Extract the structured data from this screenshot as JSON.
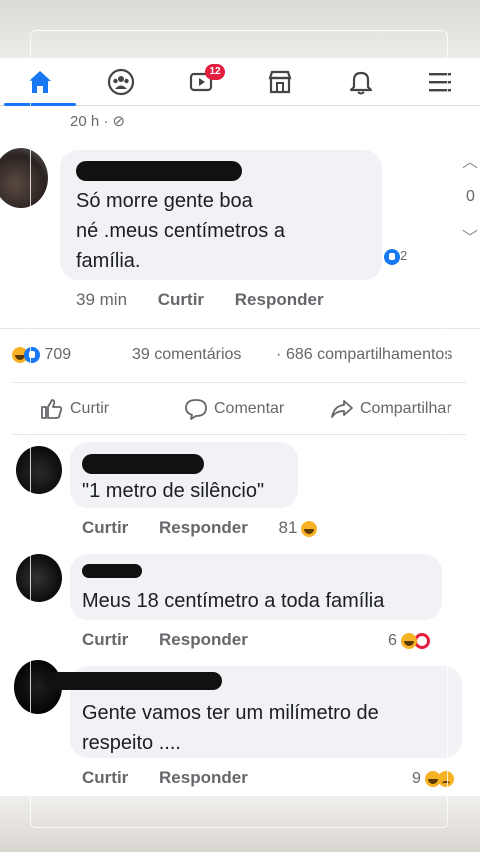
{
  "nav": {
    "notifications_badge": "12",
    "accent_color": "#1877f2",
    "icons": [
      "home-icon",
      "groups-icon",
      "watch-icon",
      "marketplace-icon",
      "bell-icon",
      "menu-icon"
    ]
  },
  "post_timestamp": "20 h · ",
  "main_comment": {
    "text_line1": "Só morre gente boa",
    "text_line2": "né .meus centímetros a",
    "text_line3": "família.",
    "reaction_count": "2",
    "time": "39 min",
    "like_label": "Curtir",
    "reply_label": "Responder",
    "side_count": "0"
  },
  "post_stats": {
    "reactions": "709",
    "comments": "39 comentários",
    "separator": "·",
    "shares": "686 compartilhamentos"
  },
  "post_actions": {
    "like": "Curtir",
    "comment": "Comentar",
    "share": "Compartilhar"
  },
  "replies": [
    {
      "text": "\"1 metro de silêncio\"",
      "like_label": "Curtir",
      "reply_label": "Responder",
      "reactions": "81"
    },
    {
      "text": "Meus 18 centímetro a toda família",
      "like_label": "Curtir",
      "reply_label": "Responder",
      "reactions": "6"
    },
    {
      "text_line1": "Gente vamos ter um milímetro de",
      "text_line2": "respeito ....",
      "like_label": "Curtir",
      "reply_label": "Responder",
      "reactions": "9"
    }
  ]
}
